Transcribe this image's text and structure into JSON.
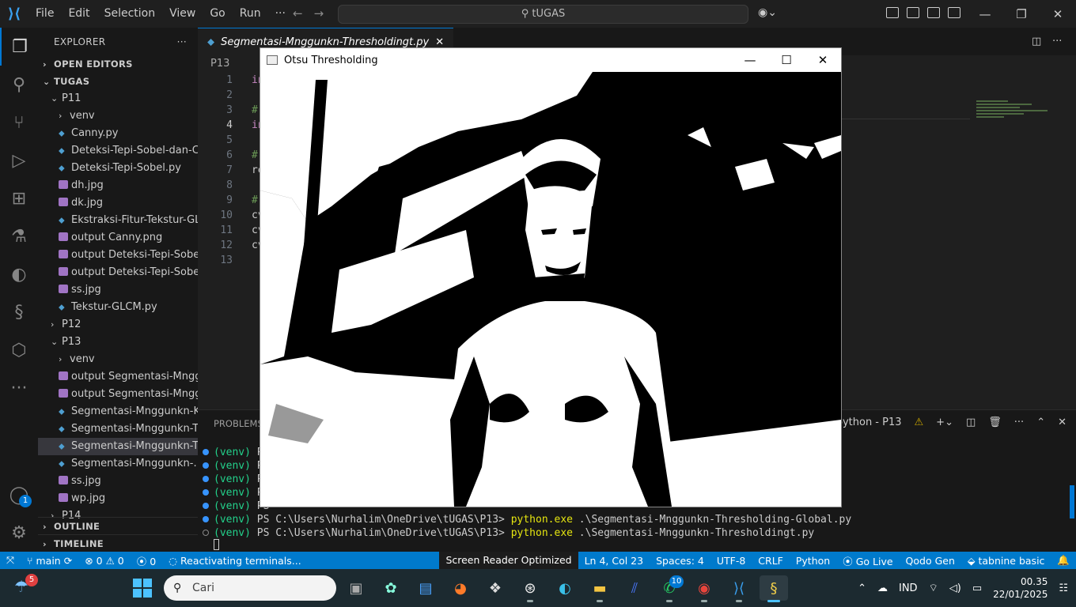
{
  "titlebar": {
    "menu": [
      "File",
      "Edit",
      "Selection",
      "View",
      "Go",
      "Run"
    ],
    "more": "···",
    "search": "tUGAS"
  },
  "explorer": {
    "title": "EXPLORER",
    "more": "···",
    "open_editors": "OPEN EDITORS",
    "root": "TUGAS",
    "items": [
      {
        "label": "P11",
        "type": "folder",
        "open": true,
        "depth": 1
      },
      {
        "label": "venv",
        "type": "folder",
        "open": false,
        "depth": 2
      },
      {
        "label": "Canny.py",
        "type": "py",
        "depth": 2
      },
      {
        "label": "Deteksi-Tepi-Sobel-dan-C...",
        "type": "py",
        "depth": 2
      },
      {
        "label": "Deteksi-Tepi-Sobel.py",
        "type": "py",
        "depth": 2
      },
      {
        "label": "dh.jpg",
        "type": "img",
        "depth": 2
      },
      {
        "label": "dk.jpg",
        "type": "img",
        "depth": 2
      },
      {
        "label": "Ekstraksi-Fitur-Tekstur-GL...",
        "type": "py",
        "depth": 2
      },
      {
        "label": "output Canny.png",
        "type": "img",
        "depth": 2
      },
      {
        "label": "output Deteksi-Tepi-Sobel...",
        "type": "img",
        "depth": 2
      },
      {
        "label": "output Deteksi-Tepi-Sobel...",
        "type": "img",
        "depth": 2
      },
      {
        "label": "ss.jpg",
        "type": "img",
        "depth": 2
      },
      {
        "label": "Tekstur-GLCM.py",
        "type": "py",
        "depth": 2
      },
      {
        "label": "P12",
        "type": "folder",
        "open": false,
        "depth": 1
      },
      {
        "label": "P13",
        "type": "folder",
        "open": true,
        "depth": 1
      },
      {
        "label": "venv",
        "type": "folder",
        "open": false,
        "depth": 2
      },
      {
        "label": "output Segmentasi-Mngg...",
        "type": "img",
        "depth": 2
      },
      {
        "label": "output Segmentasi-Mngg...",
        "type": "img",
        "depth": 2
      },
      {
        "label": "Segmentasi-Mnggunkn-K...",
        "type": "py",
        "depth": 2
      },
      {
        "label": "Segmentasi-Mnggunkn-T...",
        "type": "py",
        "depth": 2
      },
      {
        "label": "Segmentasi-Mnggunkn-T...",
        "type": "py",
        "depth": 2,
        "selected": true
      },
      {
        "label": "Segmentasi-Mnggunkn-...",
        "type": "py",
        "depth": 2
      },
      {
        "label": "ss.jpg",
        "type": "img",
        "depth": 2
      },
      {
        "label": "wp.jpg",
        "type": "img",
        "depth": 2
      },
      {
        "label": "P14",
        "type": "folder",
        "open": false,
        "depth": 1
      }
    ],
    "outline": "OUTLINE",
    "timeline": "TIMELINE"
  },
  "editor": {
    "tab": "Segmentasi-Mnggunkn-Thresholdingt.py",
    "breadcrumb": "P13",
    "line_numbers": [
      "1",
      "2",
      "3",
      "4",
      "5",
      "6",
      "7",
      "8",
      "9",
      "10",
      "11",
      "12",
      "13"
    ],
    "current_line": 4,
    "code_lines": [
      {
        "text": "in",
        "color": "#c586c0"
      },
      {
        "text": "",
        "color": "#ccc"
      },
      {
        "text": "#",
        "color": "#6a9955"
      },
      {
        "text": "in",
        "color": "#c586c0"
      },
      {
        "text": "",
        "color": "#ccc"
      },
      {
        "text": "#",
        "color": "#6a9955"
      },
      {
        "text": "re",
        "color": "#ccc"
      },
      {
        "text": "",
        "color": "#ccc"
      },
      {
        "text": "#",
        "color": "#6a9955"
      },
      {
        "text": "cv",
        "color": "#ccc"
      },
      {
        "text": "cv",
        "color": "#ccc"
      },
      {
        "text": "cv",
        "color": "#ccc"
      },
      {
        "text": "",
        "color": "#ccc"
      }
    ]
  },
  "panel": {
    "tab": "PROBLEMS",
    "terminal_name": "python - P13",
    "lines": [
      {
        "prefix": "(venv)",
        "text": " PS",
        "cmd": "",
        "dot": "filled"
      },
      {
        "prefix": "(venv)",
        "text": " PS",
        "cmd": "",
        "dot": "filled"
      },
      {
        "prefix": "(venv)",
        "text": " PS",
        "cmd": "",
        "dot": "filled"
      },
      {
        "prefix": "(venv)",
        "text": " PS",
        "cmd": "",
        "dot": "filled"
      },
      {
        "prefix": "(venv)",
        "text": " PS",
        "cmd": "",
        "dot": "filled"
      },
      {
        "prefix": "(venv)",
        "text": " PS C:\\Users\\Nurhalim\\OneDrive\\tUGAS\\P13> ",
        "cmd": "python.exe",
        "rest": " .\\Segmentasi-Mnggunkn-Thresholding-Global.py",
        "dot": "filled"
      },
      {
        "prefix": "(venv)",
        "text": " PS C:\\Users\\Nurhalim\\OneDrive\\tUGAS\\P13> ",
        "cmd": "python.exe",
        "rest": " .\\Segmentasi-Mnggunkn-Thresholdingt.py",
        "dot": "empty"
      }
    ]
  },
  "statusbar": {
    "branch": "main",
    "errors": "0",
    "warnings": "0",
    "ports": "0",
    "activity": "Reactivating terminals...",
    "screen_reader": "Screen Reader Optimized",
    "position": "Ln 4, Col 23",
    "spaces": "Spaces: 4",
    "encoding": "UTF-8",
    "eol": "CRLF",
    "language": "Python",
    "golive": "Go Live",
    "qodo": "Qodo Gen",
    "tabnine": "tabnine basic"
  },
  "cv_window": {
    "title": "Otsu Thresholding"
  },
  "taskbar": {
    "weather_badge": "5",
    "search_placeholder": "Cari",
    "whatsapp_badge": "10",
    "lang": "IND",
    "time": "00.35",
    "date": "22/01/2025"
  },
  "activity_badge": "1",
  "colors": {
    "accent": "#0078d4",
    "status": "#007acc",
    "venv": "#23d18b",
    "cmd": "#e5e510"
  }
}
